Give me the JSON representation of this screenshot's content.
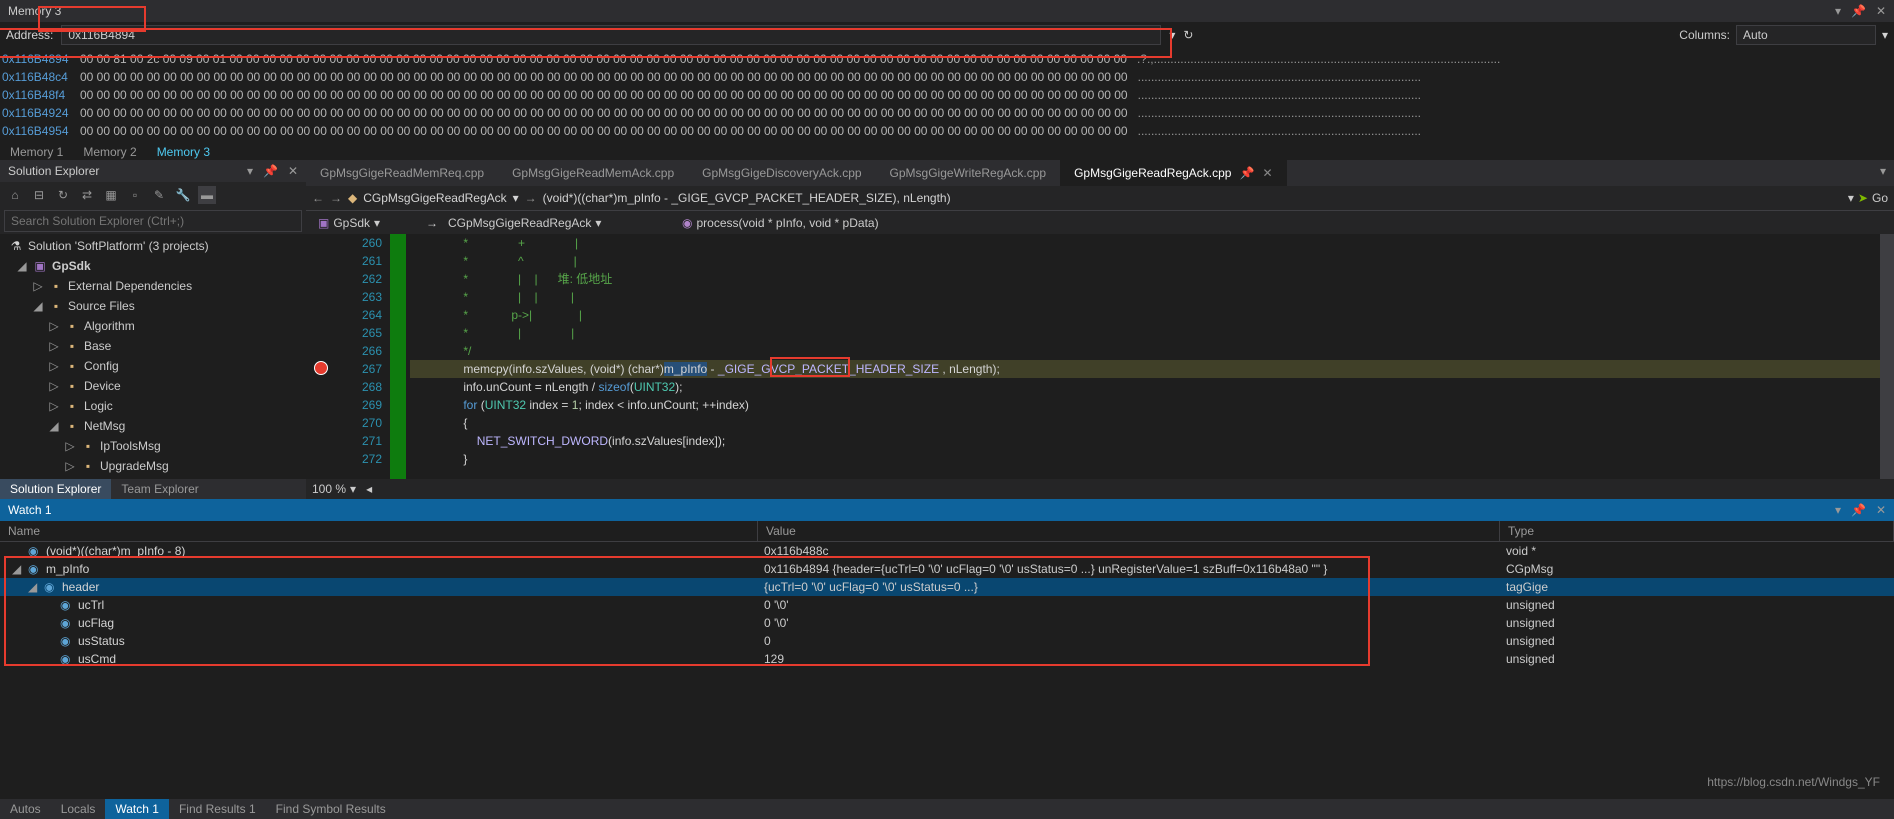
{
  "memory": {
    "title": "Memory 3",
    "address_label": "Address:",
    "address_value": "0x116B4894",
    "columns_label": "Columns:",
    "columns_value": "Auto",
    "rows": [
      {
        "addr": "0x116B4894",
        "hex": "00 00 81 00 2c 00 09 00 01 00 00 00 00 00 00 00 00 00 00 00 00 00 00 00 00 00 00 00 00 00 00 00 00 00 00 00 00 00 00 00 00 00 00 00 00 00 00 00 00 00 00 00 00 00 00 00 00 00 00 00 00 00 00",
        "ascii": ".?.,........................................................................................................"
      },
      {
        "addr": "0x116B48c4",
        "hex": "00 00 00 00 00 00 00 00 00 00 00 00 00 00 00 00 00 00 00 00 00 00 00 00 00 00 00 00 00 00 00 00 00 00 00 00 00 00 00 00 00 00 00 00 00 00 00 00 00 00 00 00 00 00 00 00 00 00 00 00 00 00 00",
        "ascii": "....................................................................................."
      },
      {
        "addr": "0x116B48f4",
        "hex": "00 00 00 00 00 00 00 00 00 00 00 00 00 00 00 00 00 00 00 00 00 00 00 00 00 00 00 00 00 00 00 00 00 00 00 00 00 00 00 00 00 00 00 00 00 00 00 00 00 00 00 00 00 00 00 00 00 00 00 00 00 00 00",
        "ascii": "....................................................................................."
      },
      {
        "addr": "0x116B4924",
        "hex": "00 00 00 00 00 00 00 00 00 00 00 00 00 00 00 00 00 00 00 00 00 00 00 00 00 00 00 00 00 00 00 00 00 00 00 00 00 00 00 00 00 00 00 00 00 00 00 00 00 00 00 00 00 00 00 00 00 00 00 00 00 00 00",
        "ascii": "....................................................................................."
      },
      {
        "addr": "0x116B4954",
        "hex": "00 00 00 00 00 00 00 00 00 00 00 00 00 00 00 00 00 00 00 00 00 00 00 00 00 00 00 00 00 00 00 00 00 00 00 00 00 00 00 00 00 00 00 00 00 00 00 00 00 00 00 00 00 00 00 00 00 00 00 00 00 00 00",
        "ascii": "....................................................................................."
      }
    ],
    "tabs": [
      "Memory 1",
      "Memory 2",
      "Memory 3"
    ]
  },
  "solution": {
    "title": "Solution Explorer",
    "search_placeholder": "Search Solution Explorer (Ctrl+;)",
    "root": "Solution 'SoftPlatform' (3 projects)",
    "project": "GpSdk",
    "nodes": [
      {
        "indent": 1,
        "toggle": "▷",
        "icon": "📁",
        "label": "External Dependencies"
      },
      {
        "indent": 1,
        "toggle": "◢",
        "icon": "📁",
        "label": "Source Files"
      },
      {
        "indent": 2,
        "toggle": "▷",
        "icon": "📁",
        "label": "Algorithm"
      },
      {
        "indent": 2,
        "toggle": "▷",
        "icon": "📁",
        "label": "Base"
      },
      {
        "indent": 2,
        "toggle": "▷",
        "icon": "📁",
        "label": "Config"
      },
      {
        "indent": 2,
        "toggle": "▷",
        "icon": "📁",
        "label": "Device"
      },
      {
        "indent": 2,
        "toggle": "▷",
        "icon": "📁",
        "label": "Logic"
      },
      {
        "indent": 2,
        "toggle": "◢",
        "icon": "📁",
        "label": "NetMsg"
      },
      {
        "indent": 3,
        "toggle": "▷",
        "icon": "📁",
        "label": "IpToolsMsg"
      },
      {
        "indent": 3,
        "toggle": "▷",
        "icon": "📁",
        "label": "UpgradeMsg"
      }
    ],
    "bottom_tabs": [
      "Solution Explorer",
      "Team Explorer"
    ]
  },
  "editor": {
    "tabs": [
      "GpMsgGigeReadMemReq.cpp",
      "GpMsgGigeReadMemAck.cpp",
      "GpMsgGigeDiscoveryAck.cpp",
      "GpMsgGigeWriteRegAck.cpp",
      "GpMsgGigeReadRegAck.cpp"
    ],
    "nav": {
      "class": "CGpMsgGigeReadRegAck",
      "method": "(void*)((char*)m_pInfo - _GIGE_GVCP_PACKET_HEADER_SIZE), nLength)"
    },
    "context": {
      "project": "GpSdk",
      "class": "CGpMsgGigeReadRegAck",
      "method": "process(void * pInfo, void * pData)"
    },
    "go_label": "Go",
    "lines": {
      "l260": "                *               +               |",
      "l261": "                *               ^               |",
      "l262": "                *               |    |      堆: 低地址",
      "l263": "                *               |    |          |",
      "l264": "                *             p->|              |",
      "l265": "                *               |               |",
      "l266": "                */",
      "l267": "                memcpy(info.szValues, (void*) (char*)m_pInfo - _GIGE_GVCP_PACKET_HEADER_SIZE , nLength);",
      "l267_a": "                memcpy(info.szValues, (void*) (char*)",
      "l267_b": "m_pInfo",
      "l267_c": " - ",
      "l267_d": "_GIGE_GVCP_PACKET_HEADER_SIZE",
      "l267_e": " , nLength);",
      "l268": "                info.unCount = nLength / sizeof(UINT32);",
      "l269": "                for (UINT32 index = 1; index < info.unCount; ++index)",
      "l270": "                {",
      "l271": "                    NET_SWITCH_DWORD(info.szValues[index]);",
      "l272": "                }"
    },
    "linenums": [
      "260",
      "261",
      "262",
      "263",
      "264",
      "265",
      "266",
      "267",
      "268",
      "269",
      "270",
      "271",
      "272"
    ],
    "zoom": "100 %"
  },
  "watch": {
    "title": "Watch 1",
    "headers": {
      "name": "Name",
      "value": "Value",
      "type": "Type"
    },
    "rows": [
      {
        "indent": 0,
        "toggle": "",
        "name": "(void*)((char*)m_pInfo - 8)",
        "value": "0x116b488c",
        "type": "void *"
      },
      {
        "indent": 0,
        "toggle": "◢",
        "name": "m_pInfo",
        "value": "0x116b4894 {header={ucTrl=0 '\\0' ucFlag=0 '\\0' usStatus=0 ...} unRegisterValue=1 szBuff=0x116b48a0 \"\" }",
        "type": "CGpMsg"
      },
      {
        "indent": 1,
        "toggle": "◢",
        "name": "header",
        "value": "{ucTrl=0 '\\0' ucFlag=0 '\\0' usStatus=0 ...}",
        "type": "tagGige",
        "selected": true
      },
      {
        "indent": 2,
        "toggle": "",
        "name": "ucTrl",
        "value": "0 '\\0'",
        "type": "unsigned"
      },
      {
        "indent": 2,
        "toggle": "",
        "name": "ucFlag",
        "value": "0 '\\0'",
        "type": "unsigned"
      },
      {
        "indent": 2,
        "toggle": "",
        "name": "usStatus",
        "value": "0",
        "type": "unsigned"
      },
      {
        "indent": 2,
        "toggle": "",
        "name": "usCmd",
        "value": "129",
        "type": "unsigned"
      }
    ],
    "bottom_tabs": [
      "Autos",
      "Locals",
      "Watch 1",
      "Find Results 1",
      "Find Symbol Results"
    ]
  },
  "watermark": "https://blog.csdn.net/Windgs_YF"
}
